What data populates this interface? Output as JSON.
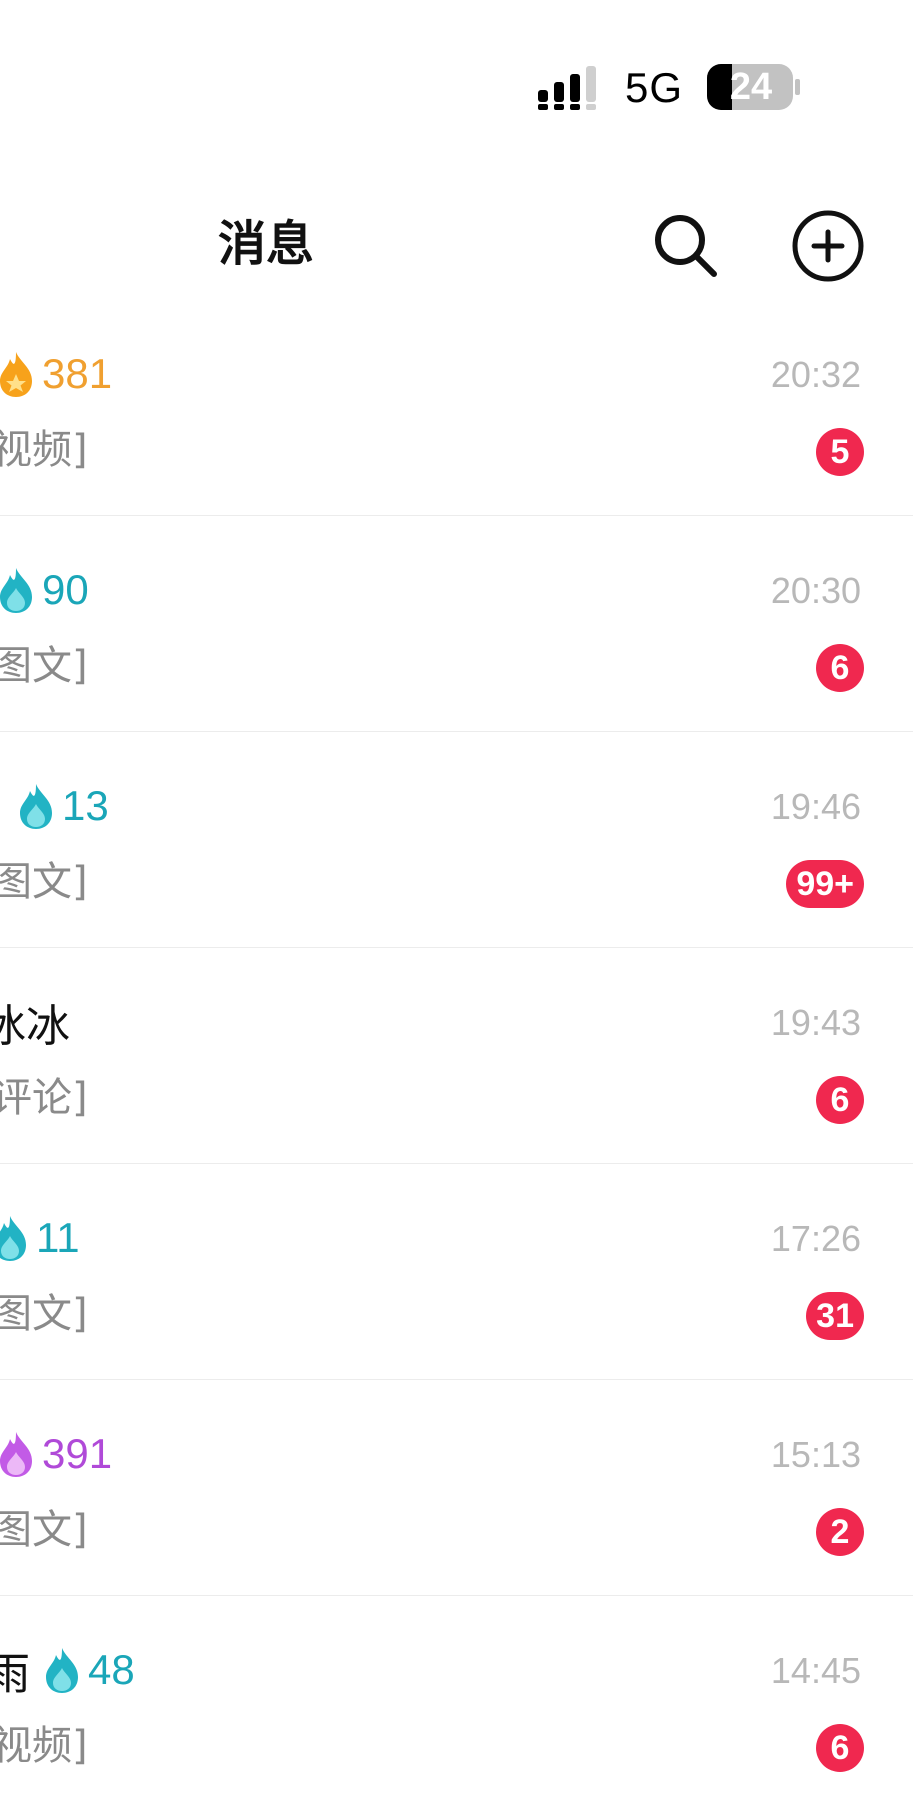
{
  "status_bar": {
    "network": "5G",
    "battery": "24"
  },
  "header": {
    "title": "消息"
  },
  "conversations": [
    {
      "name": "",
      "flame": "gold-flame-icon",
      "streak": "381",
      "streak_color": "#f0a030",
      "preview": "视频]",
      "time": "20:32",
      "unread": "5"
    },
    {
      "name": "",
      "flame": "teal-flame-icon",
      "streak": "90",
      "streak_color": "#1aa6b8",
      "preview": "图文]",
      "time": "20:30",
      "unread": "6"
    },
    {
      "name": "",
      "flame": "teal-flame-icon",
      "streak": "13",
      "streak_color": "#1aa6b8",
      "preview": "图文]",
      "time": "19:46",
      "unread": "99+"
    },
    {
      "name": "冰冰",
      "flame": "",
      "streak": "",
      "streak_color": "#1aa6b8",
      "preview": "评论]",
      "time": "19:43",
      "unread": "6"
    },
    {
      "name": "",
      "flame": "teal-flame-icon",
      "streak": "11",
      "streak_color": "#1aa6b8",
      "preview": "图文]",
      "time": "17:26",
      "unread": "31"
    },
    {
      "name": "",
      "flame": "purple-flame-icon",
      "streak": "391",
      "streak_color": "#b04ad8",
      "preview": "图文]",
      "time": "15:13",
      "unread": "2"
    },
    {
      "name": "雨",
      "flame": "teal-flame-icon",
      "streak": "48",
      "streak_color": "#1aa6b8",
      "preview": "视频]",
      "time": "14:45",
      "unread": "6"
    }
  ],
  "colors": {
    "badge": "#f0284f",
    "time": "#b8b8b8",
    "preview": "#8a8a8a",
    "flame_gold": "#f0a030",
    "flame_teal": "#1aa6b8",
    "flame_purple": "#b04ad8"
  }
}
